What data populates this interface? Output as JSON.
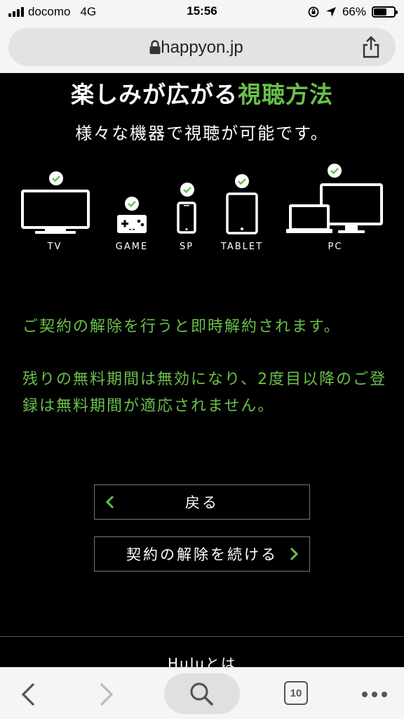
{
  "status_bar": {
    "carrier": "docomo",
    "network": "4G",
    "time": "15:56",
    "battery_percent": "66%",
    "battery_level": 0.66
  },
  "address_bar": {
    "url": "happyon.jp"
  },
  "main": {
    "heading_part1": "楽しみが広がる",
    "heading_part2": "視聴方法",
    "subheading": "様々な機器で視聴が可能です。",
    "devices": [
      {
        "label": "TV"
      },
      {
        "label": "GAME"
      },
      {
        "label": "SP"
      },
      {
        "label": "TABLET"
      },
      {
        "label": "PC"
      }
    ],
    "notice1": "ご契約の解除を行うと即時解約されます。",
    "notice2": "残りの無料期間は無効になり、2度目以降のご登録は無料期間が適応されません。",
    "back_button": "戻る",
    "continue_button": "契約の解除を続ける",
    "footer_link": "Huluとは"
  },
  "toolbar": {
    "tab_count": "10"
  },
  "colors": {
    "accent": "#6bc04b",
    "background": "#000000"
  }
}
